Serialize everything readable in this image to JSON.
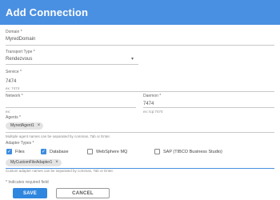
{
  "dialog": {
    "title": "Add Connection"
  },
  "domain": {
    "label": "Domain *",
    "value": "MyredDomain"
  },
  "transport": {
    "label": "Transport Type *",
    "value": "Rendezvous",
    "caret": "▾"
  },
  "service": {
    "label": "Service *",
    "value": "7474",
    "hint": "ex: 7474"
  },
  "network": {
    "label": "Network *",
    "value": "",
    "hint": "ex:"
  },
  "daemon": {
    "label": "Daemon *",
    "value": "7474",
    "hint": "ex: tcp:7474"
  },
  "agents": {
    "label": "Agents *",
    "chips": [
      {
        "text": "MyredAgent1",
        "close": "×"
      }
    ],
    "hint": "Multiple agent names can be separated by commas, Tab or Enter."
  },
  "adapter_types": {
    "label": "Adapter Types *",
    "options": [
      {
        "label": "Files",
        "checked": true
      },
      {
        "label": "Database",
        "checked": true
      },
      {
        "label": "WebSphere MQ",
        "checked": false
      },
      {
        "label": "SAP (TIBCO Business Studio)",
        "checked": false
      }
    ],
    "custom_chips": [
      {
        "text": "MyCustomFileAdapter1",
        "close": "×"
      }
    ],
    "hint": "Custom adapter names can be separated by commas, Tab or Enter."
  },
  "required_note": "* Indicates required field",
  "buttons": {
    "save": "SAVE",
    "cancel": "CANCEL"
  },
  "colors": {
    "header": "#4a90e2",
    "primary_button": "#2f86de",
    "checkbox_checked": "#3b8de0"
  }
}
